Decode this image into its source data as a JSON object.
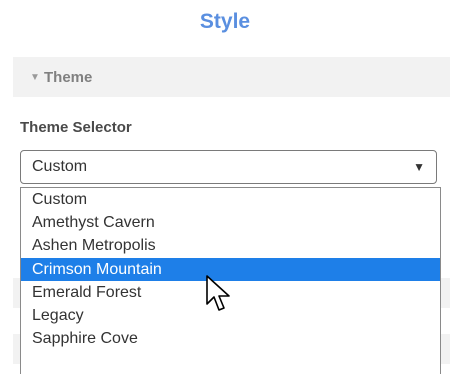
{
  "panel": {
    "title": "Style"
  },
  "section": {
    "title": "Theme",
    "expanded": true
  },
  "theme_selector": {
    "label": "Theme Selector",
    "current_value": "Custom",
    "options": [
      "Custom",
      "Amethyst Cavern",
      "Ashen Metropolis",
      "Crimson Mountain",
      "Emerald Forest",
      "Legacy",
      "Sapphire Cove"
    ],
    "highlighted_option": "Crimson Mountain"
  },
  "colors": {
    "title_blue": "#5a8fe0",
    "highlight_blue": "#1e7fe8",
    "header_bg": "#f2f2f2"
  },
  "icons": {
    "section_toggle": "triangle-down-icon",
    "select_caret": "caret-down-icon",
    "pointer": "mouse-pointer-icon"
  }
}
